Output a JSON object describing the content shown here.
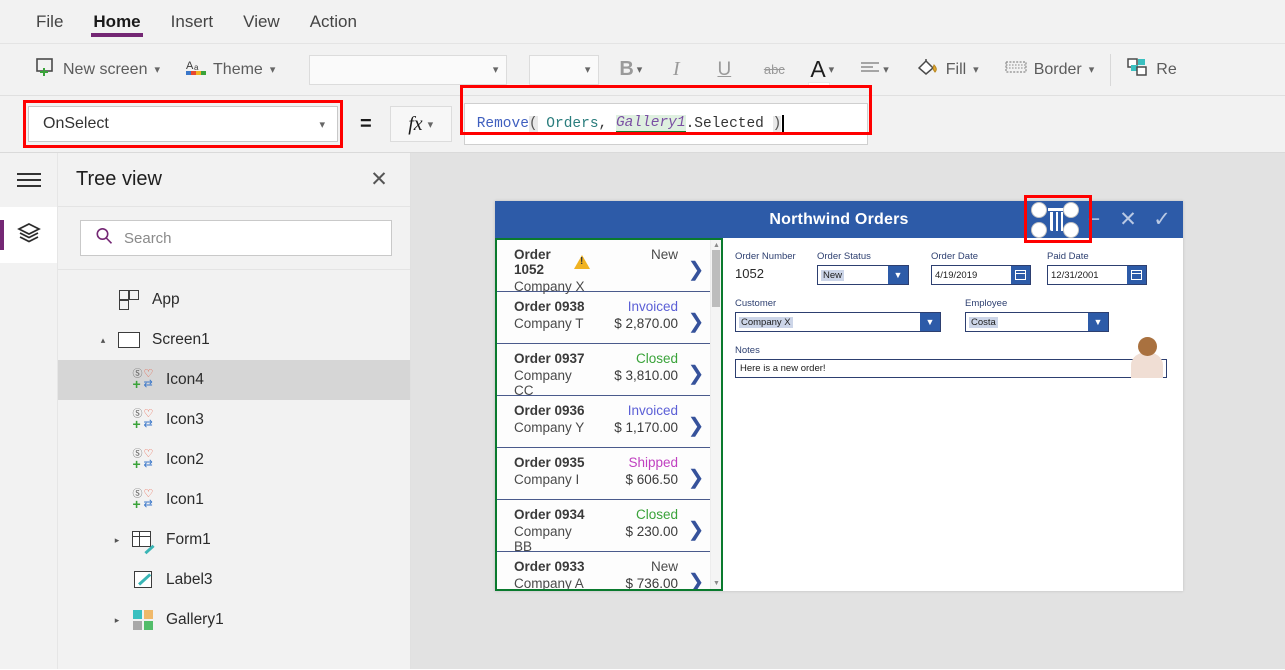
{
  "ribbon": {
    "tabs": [
      {
        "label": "File",
        "active": false
      },
      {
        "label": "Home",
        "active": true
      },
      {
        "label": "Insert",
        "active": false
      },
      {
        "label": "View",
        "active": false
      },
      {
        "label": "Action",
        "active": false
      }
    ]
  },
  "command_bar": {
    "new_screen": "New screen",
    "theme": "Theme",
    "font_value": "",
    "font_size_value": "",
    "bold": "B",
    "italic": "I",
    "underline": "U",
    "strikethrough": "abc",
    "font_color": "A",
    "font_color_swatch": "#ffffff",
    "align": "align-left",
    "fill": "Fill",
    "border": "Border",
    "reorder": "Re"
  },
  "formula_bar": {
    "property_selected": "OnSelect",
    "equals": "=",
    "fx": "fx",
    "formula_text": "Remove( Orders, Gallery1.Selected )",
    "tokens": [
      {
        "text": "Remove",
        "type": "fn"
      },
      {
        "text": "(",
        "type": "paren"
      },
      {
        "text": " Orders",
        "type": "table"
      },
      {
        "text": ",",
        "type": "punct"
      },
      {
        "text": " ",
        "type": "punct"
      },
      {
        "text": "Gallery1",
        "type": "ctrl"
      },
      {
        "text": ".Selected ",
        "type": "prop"
      },
      {
        "text": ")",
        "type": "paren"
      }
    ],
    "annotation_color": "#ff0000"
  },
  "left_rail": {
    "hamburger": "hamburger-menu",
    "active_item": "tree-view-layers",
    "accent_color": "#742774"
  },
  "tree_view": {
    "title": "Tree view",
    "close": "✕",
    "search_placeholder": "Search",
    "nodes": [
      {
        "label": "App",
        "icon": "app-icon",
        "depth": "app",
        "expander": "",
        "selected": false
      },
      {
        "label": "Screen1",
        "icon": "screen-icon",
        "depth": "screen",
        "expander": "▴",
        "selected": false
      },
      {
        "label": "Icon4",
        "icon": "icon-control-icon",
        "depth": "child",
        "expander": "",
        "selected": true
      },
      {
        "label": "Icon3",
        "icon": "icon-control-icon",
        "depth": "child",
        "expander": "",
        "selected": false
      },
      {
        "label": "Icon2",
        "icon": "icon-control-icon",
        "depth": "child",
        "expander": "",
        "selected": false
      },
      {
        "label": "Icon1",
        "icon": "icon-control-icon",
        "depth": "child",
        "expander": "",
        "selected": false
      },
      {
        "label": "Form1",
        "icon": "form-icon",
        "depth": "child2",
        "expander": "▸",
        "selected": false
      },
      {
        "label": "Label3",
        "icon": "label-icon",
        "depth": "child",
        "expander": "",
        "selected": false
      },
      {
        "label": "Gallery1",
        "icon": "gallery-icon",
        "depth": "child2",
        "expander": "▸",
        "selected": false
      }
    ]
  },
  "app_preview": {
    "title": "Northwind Orders",
    "header_color": "#2d5ba8",
    "selection_border_color": "#0a7a2e",
    "header_icons": [
      "minus-icon",
      "close-icon",
      "check-icon"
    ],
    "selected_control": "trash-icon",
    "gallery": {
      "rows": [
        {
          "order": "Order 1052",
          "company": "Company X",
          "status": "New",
          "status_color": "#4a4a4a",
          "amount": "",
          "warning": true
        },
        {
          "order": "Order 0938",
          "company": "Company T",
          "status": "Invoiced",
          "status_color": "#5b5fd6",
          "amount": "$ 2,870.00",
          "warning": false
        },
        {
          "order": "Order 0937",
          "company": "Company CC",
          "status": "Closed",
          "status_color": "#3aa33a",
          "amount": "$ 3,810.00",
          "warning": false
        },
        {
          "order": "Order 0936",
          "company": "Company Y",
          "status": "Invoiced",
          "status_color": "#5b5fd6",
          "amount": "$ 1,170.00",
          "warning": false
        },
        {
          "order": "Order 0935",
          "company": "Company I",
          "status": "Shipped",
          "status_color": "#c040c0",
          "amount": "$ 606.50",
          "warning": false
        },
        {
          "order": "Order 0934",
          "company": "Company BB",
          "status": "Closed",
          "status_color": "#3aa33a",
          "amount": "$ 230.00",
          "warning": false
        },
        {
          "order": "Order 0933",
          "company": "Company A",
          "status": "New",
          "status_color": "#4a4a4a",
          "amount": "$ 736.00",
          "warning": false
        }
      ]
    },
    "form": {
      "order_number_label": "Order Number",
      "order_number_value": "1052",
      "order_status_label": "Order Status",
      "order_status_value": "New",
      "order_date_label": "Order Date",
      "order_date_value": "4/19/2019",
      "paid_date_label": "Paid Date",
      "paid_date_value": "12/31/2001",
      "customer_label": "Customer",
      "customer_value": "Company X",
      "employee_label": "Employee",
      "employee_value": "Costa",
      "notes_label": "Notes",
      "notes_value": "Here is a new order!"
    }
  }
}
